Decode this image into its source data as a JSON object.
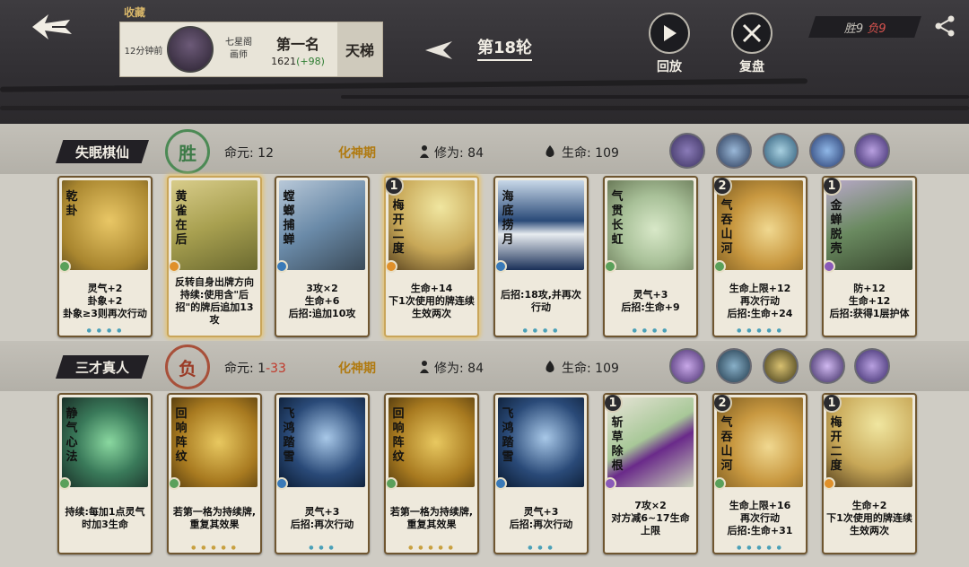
{
  "header": {
    "favorite_label": "收藏",
    "time_ago": "12分钟前",
    "player_org": "七星阁",
    "player_title": "画师",
    "rank": "第一名",
    "score": "1621",
    "score_delta": "(+98)",
    "ladder_label": "天梯",
    "round_label": "第18轮",
    "replay_label": "回放",
    "review_label": "复盘",
    "record_win": "胜9",
    "record_lose": "负9"
  },
  "players": [
    {
      "name": "失眠棋仙",
      "result": "胜",
      "life_label": "命元:",
      "life": "12",
      "life_delta": "",
      "realm": "化神期",
      "cultivation_label": "修为:",
      "cultivation": "84",
      "hp_label": "生命:",
      "hp": "109",
      "cards": [
        {
          "title": "乾卦",
          "level": "",
          "desc": "灵气+2\n卦象+2\n卦象≥3则再次行动",
          "highlight": false
        },
        {
          "title": "黄雀在后",
          "level": "",
          "desc": "反转自身出牌方向\n持续:使用含\"后招\"的牌后追加13攻",
          "highlight": true
        },
        {
          "title": "螳螂捕蝉",
          "level": "",
          "desc": "3攻×2\n生命+6\n后招:追加10攻",
          "highlight": false
        },
        {
          "title": "梅开二度",
          "level": "1",
          "desc": "生命+14\n下1次使用的牌连续生效两次",
          "highlight": true
        },
        {
          "title": "海底捞月",
          "level": "",
          "desc": "后招:18攻,并再次行动",
          "highlight": false
        },
        {
          "title": "气贯长虹",
          "level": "",
          "desc": "灵气+3\n后招:生命+9",
          "highlight": false
        },
        {
          "title": "气吞山河",
          "level": "2",
          "desc": "生命上限+12\n再次行动\n后招:生命+24",
          "highlight": false
        },
        {
          "title": "金蝉脱壳",
          "level": "1",
          "desc": "防+12\n生命+12\n后招:获得1层护体",
          "highlight": false
        }
      ]
    },
    {
      "name": "三才真人",
      "result": "负",
      "life_label": "命元:",
      "life": "1",
      "life_delta": "-33",
      "realm": "化神期",
      "cultivation_label": "修为:",
      "cultivation": "84",
      "hp_label": "生命:",
      "hp": "109",
      "cards": [
        {
          "title": "静气心法",
          "level": "",
          "desc": "持续:每加1点灵气时加3生命",
          "highlight": false
        },
        {
          "title": "回响阵纹",
          "level": "",
          "desc": "若第一格为持续牌,重复其效果",
          "highlight": false
        },
        {
          "title": "飞鸿踏雪",
          "level": "",
          "desc": "灵气+3\n后招:再次行动",
          "highlight": false
        },
        {
          "title": "回响阵纹",
          "level": "",
          "desc": "若第一格为持续牌,重复其效果",
          "highlight": false
        },
        {
          "title": "飞鸿踏雪",
          "level": "",
          "desc": "灵气+3\n后招:再次行动",
          "highlight": false
        },
        {
          "title": "斩草除根",
          "level": "1",
          "desc": "7攻×2\n对方减6~17生命上限",
          "highlight": false
        },
        {
          "title": "气吞山河",
          "level": "2",
          "desc": "生命上限+16\n再次行动\n后招:生命+31",
          "highlight": false
        },
        {
          "title": "梅开二度",
          "level": "1",
          "desc": "生命+2\n下1次使用的牌连续生效两次",
          "highlight": false
        }
      ]
    }
  ],
  "colors": {
    "accent_gold": "#b07a10",
    "win_green": "#3b7a46",
    "lose_red": "#9b3b26",
    "delta_green": "#2e7d32"
  }
}
